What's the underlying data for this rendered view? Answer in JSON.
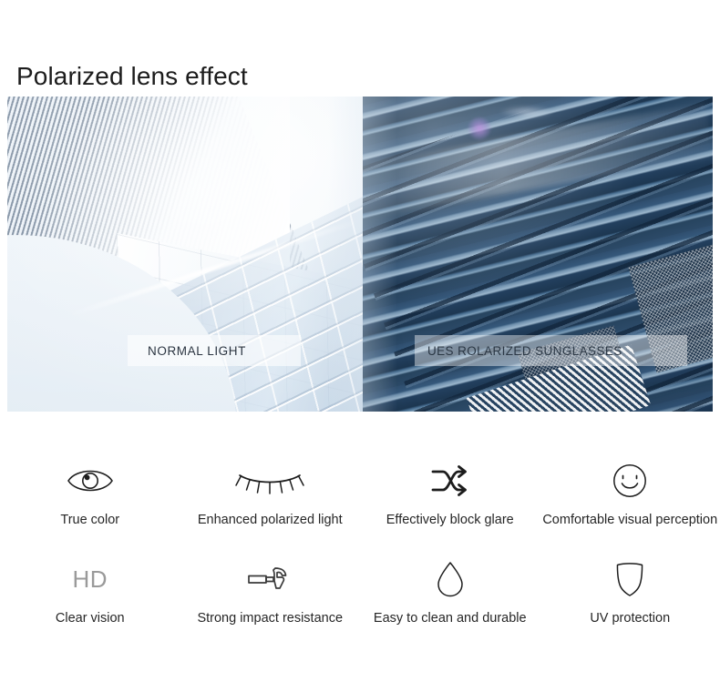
{
  "page": {
    "title": "Polarized lens effect",
    "background_color": "#ffffff"
  },
  "hero": {
    "left_caption": "NORMAL  LIGHT",
    "right_caption": "UES ROLARIZED SUNGLASSES",
    "left_alt": "hazy washed-out skyscraper facade under normal light",
    "right_alt": "saturated blue skyscraper facade seen through polarized sunglasses",
    "colors": {
      "normal_light_tint": "#e7eff6",
      "polarized_tint": "#2f4e6e",
      "plate_background": "rgba(255,255,255,0.58)"
    }
  },
  "features": {
    "rows": [
      {
        "items": [
          {
            "icon": "eye-icon",
            "label": "True color"
          },
          {
            "icon": "eyelash-icon",
            "label": "Enhanced polarized light"
          },
          {
            "icon": "shuffle-arrows-icon",
            "label": "Effectively block glare"
          },
          {
            "icon": "smiley-face-icon",
            "label": "Comfortable visual perception"
          }
        ]
      },
      {
        "items": [
          {
            "icon": "hd-text-icon",
            "icon_text": "HD",
            "label": "Clear vision"
          },
          {
            "icon": "hammer-icon",
            "label": "Strong impact resistance"
          },
          {
            "icon": "water-droplet-icon",
            "label": "Easy to clean and durable"
          },
          {
            "icon": "shield-icon",
            "label": "UV protection"
          }
        ]
      }
    ]
  }
}
